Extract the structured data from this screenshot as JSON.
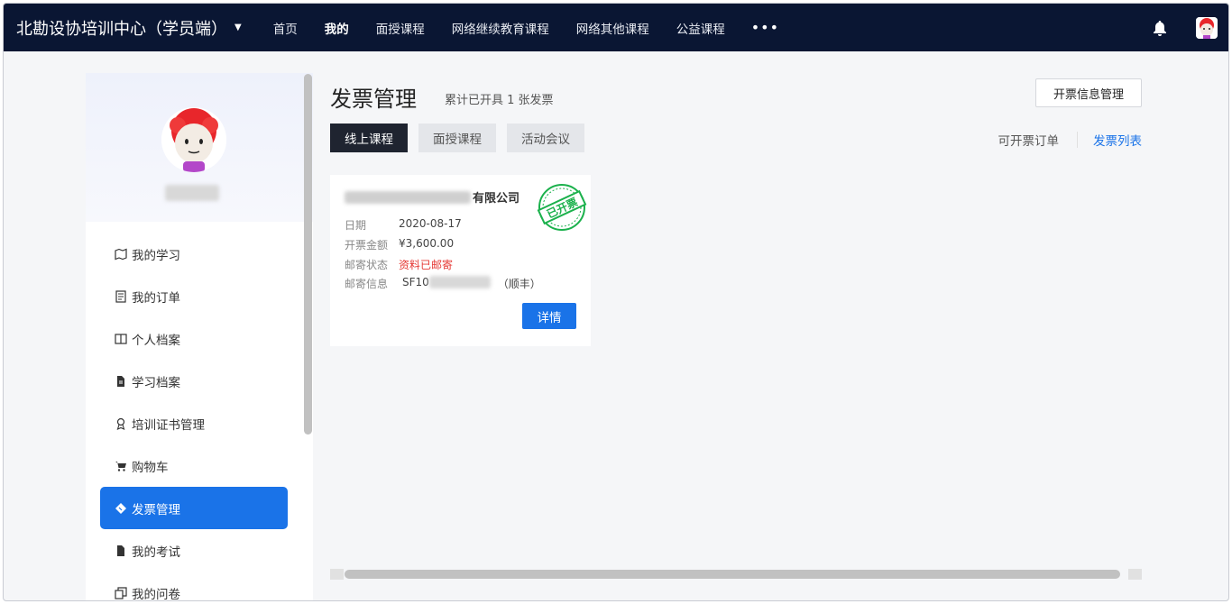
{
  "brand": {
    "title": "北勘设协培训中心（学员端）",
    "caret": "▼"
  },
  "nav": {
    "links": [
      "首页",
      "我的",
      "面授课程",
      "网络继续教育课程",
      "网络其他课程",
      "公益课程"
    ],
    "more": "•••"
  },
  "sidebar": {
    "items": [
      {
        "label": "我的学习",
        "icon": "map-icon"
      },
      {
        "label": "我的订单",
        "icon": "order-icon"
      },
      {
        "label": "个人档案",
        "icon": "book-icon"
      },
      {
        "label": "学习档案",
        "icon": "file-icon"
      },
      {
        "label": "培训证书管理",
        "icon": "award-icon"
      },
      {
        "label": "购物车",
        "icon": "cart-icon"
      },
      {
        "label": "发票管理",
        "icon": "ticket-icon",
        "active": true
      },
      {
        "label": "我的考试",
        "icon": "file-icon"
      },
      {
        "label": "我的问卷",
        "icon": "copy-icon"
      }
    ]
  },
  "main": {
    "title": "发票管理",
    "summary": "累计已开具 1 张发票",
    "info_button": "开票信息管理",
    "tabs": [
      "线上课程",
      "面授课程",
      "活动会议"
    ],
    "subnav": {
      "orders": "可开票订单",
      "list": "发票列表"
    }
  },
  "invoice_card": {
    "company_suffix": "有限公司",
    "stamp": "已开票",
    "date_label": "日期",
    "date": "2020-08-17",
    "amount_label": "开票金额",
    "amount": "¥3,600.00",
    "mail_status_label": "邮寄状态",
    "mail_status": "资料已邮寄",
    "mail_info_label": "邮寄信息",
    "mail_info_prefix": "SF10",
    "mail_info_carrier": "（顺丰）",
    "detail_button": "详情"
  },
  "colors": {
    "nav_bg": "#0a1633",
    "accent": "#1a73e8",
    "active_tab": "#1f2430",
    "stamp": "#1bb14c",
    "status_red": "#e53935"
  }
}
